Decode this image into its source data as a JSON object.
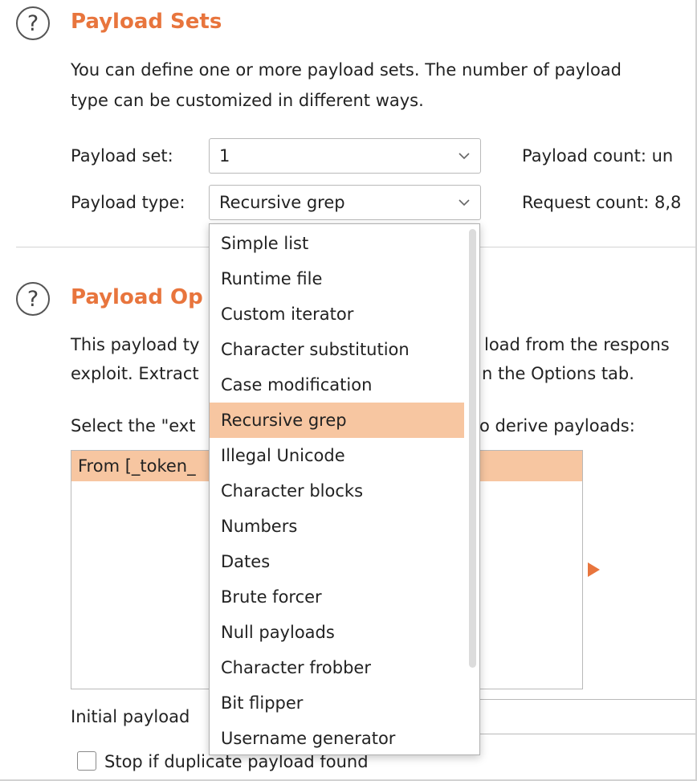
{
  "sets": {
    "title": "Payload Sets",
    "desc_line1": "You can define one or more payload sets. The number of payload",
    "desc_line2": "type can be customized in different ways.",
    "set_label": "Payload set:",
    "set_value": "1",
    "type_label": "Payload type:",
    "type_value": "Recursive grep",
    "payload_count": "Payload count:  un",
    "request_count": "Request count:  8,8"
  },
  "options": {
    "title": "Payload Op",
    "desc_line1_a": "This payload ty",
    "desc_line1_b": "load from the respons",
    "desc_line2_a": "exploit. Extract",
    "desc_line2_b": "n the Options tab.",
    "select_a": "Select the \"ext",
    "select_b": "o derive payloads:",
    "list_row": "From [_token_",
    "initial_label": "Initial payload",
    "stop_label": "Stop if duplicate payload found"
  },
  "dropdown": {
    "items": [
      "Simple list",
      "Runtime file",
      "Custom iterator",
      "Character substitution",
      "Case modification",
      "Recursive grep",
      "Illegal Unicode",
      "Character blocks",
      "Numbers",
      "Dates",
      "Brute forcer",
      "Null payloads",
      "Character frobber",
      "Bit flipper",
      "Username generator"
    ],
    "selected_index": 5
  },
  "colors": {
    "accent": "#e8753d",
    "selection": "#f7c6a1"
  },
  "icons": {
    "help": "?"
  }
}
